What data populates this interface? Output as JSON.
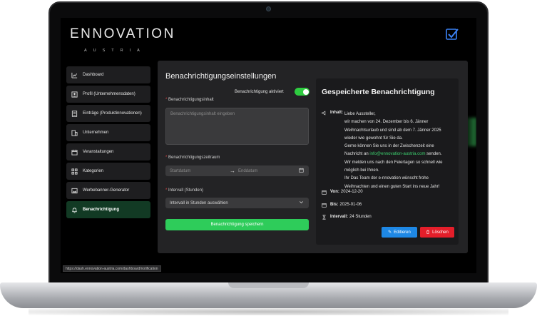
{
  "logo": {
    "main": "ENNOVATION",
    "sub": "AUSTRIA"
  },
  "header": {
    "icon": "check-square-icon",
    "accent": "#3b82f6"
  },
  "sidebar": {
    "items": [
      {
        "label": "Dashboard",
        "icon": "chart-icon"
      },
      {
        "label": "Profil (Unternehmensdaten)",
        "icon": "profile-icon"
      },
      {
        "label": "Einträge (Produktinnovationen)",
        "icon": "list-icon"
      },
      {
        "label": "Unternehmen",
        "icon": "building-icon"
      },
      {
        "label": "Veranstaltungen",
        "icon": "calendar-icon"
      },
      {
        "label": "Kategorien",
        "icon": "grid-icon"
      },
      {
        "label": "Werbebanner-Generator",
        "icon": "image-icon"
      },
      {
        "label": "Benachrichtigung",
        "icon": "bell-icon",
        "active": true
      }
    ]
  },
  "form": {
    "title": "Benachrichtigungseinstellungen",
    "toggle_label": "Benachrichtigung aktiviert",
    "toggle_on": true,
    "content_label": "Benachrichtigungsinhalt",
    "content_placeholder": "Benachrichtigungsinhalt eingeben",
    "period_label": "Benachrichtigungszeitraum",
    "start_placeholder": "Startdatum",
    "end_placeholder": "Enddatum",
    "interval_label": "Intervall (Stunden)",
    "interval_value": "Intervall in Stunden auswählen",
    "save_label": "Benachrichtigung speichern"
  },
  "saved": {
    "title": "Gespeicherte Benachrichtigung",
    "content_label": "Inhalt:",
    "content_lines": [
      "Liebe Aussteller,",
      "wir machen von 24. Dezember bis 6. Jänner",
      "Weihnachtsurlaub und sind ab dem 7. Jänner 2025",
      "wieder wie gewohnt für Sie da.",
      "Gerne können Sie uns in der Zwischenzeit eine",
      "Nachricht an",
      "info@ennovation-austria.com",
      "senden.",
      "Wir melden uns nach den Feiertagen so schnell wie",
      "möglich bei Ihnen.",
      "Ihr Das Team der e-nnovation wünscht frohe",
      "Weihnachten und einen guten Start ins neue Jahr!"
    ],
    "from_label": "Von:",
    "from_value": "2024-12-20",
    "to_label": "Bis:",
    "to_value": "2025-01-06",
    "interval_label": "Intervall:",
    "interval_value": "24 Stunden",
    "edit_label": "Editieren",
    "delete_label": "Löschen"
  },
  "status_url": "https://dash.ennovation-austria.com/dashboard/notification",
  "colors": {
    "green": "#2ecc5a",
    "blue": "#1e88e5",
    "red": "#e41e2a"
  }
}
